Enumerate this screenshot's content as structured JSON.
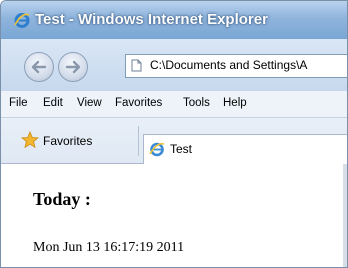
{
  "window": {
    "title": "Test - Windows Internet Explorer"
  },
  "nav": {
    "address": "C:\\Documents and Settings\\A"
  },
  "menu": {
    "items": [
      "File",
      "Edit",
      "View",
      "Favorites",
      "Tools",
      "Help"
    ]
  },
  "favorites_bar": {
    "favorites_label": "Favorites",
    "tab_label": "Test"
  },
  "content": {
    "heading": "Today :",
    "datetime": "Mon Jun 13 16:17:19 2011"
  },
  "icons": {
    "app": "ie-logo-icon",
    "back": "back-arrow-icon",
    "forward": "forward-arrow-icon",
    "page": "page-icon",
    "favorites": "star-icon",
    "tab": "ie-tab-icon"
  },
  "colors": {
    "titlebar": "#8fb4dc",
    "navbar": "#c7d8ee",
    "menubar": "#eef3fa",
    "favbar": "#dfe8f4",
    "content_bg": "#ffffff"
  }
}
